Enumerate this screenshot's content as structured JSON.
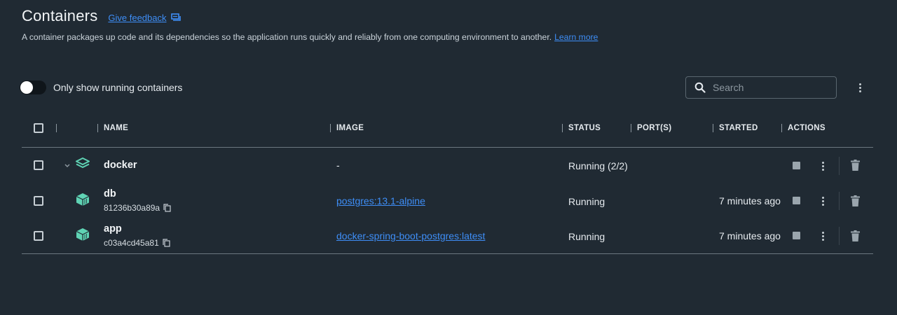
{
  "header": {
    "title": "Containers",
    "feedback_label": "Give feedback",
    "description": "A container packages up code and its dependencies so the application runs quickly and reliably from one computing environment to another.",
    "learn_more": "Learn more"
  },
  "filter": {
    "toggle_label": "Only show running containers",
    "toggle_on": false
  },
  "search": {
    "placeholder": "Search"
  },
  "table": {
    "columns": [
      "NAME",
      "IMAGE",
      "STATUS",
      "PORT(S)",
      "STARTED",
      "ACTIONS"
    ],
    "group": {
      "name": "docker",
      "image": "-",
      "status": "Running (2/2)",
      "expanded": true
    },
    "rows": [
      {
        "name": "db",
        "id": "81236b30a89a",
        "image": "postgres:13.1-alpine",
        "status": "Running",
        "started": "7 minutes ago"
      },
      {
        "name": "app",
        "id": "c03a4cd45a81",
        "image": "docker-spring-boot-postgres:latest",
        "status": "Running",
        "started": "7 minutes ago"
      }
    ]
  },
  "colors": {
    "background": "#202a33",
    "link": "#3e8ef7",
    "container_icon": "#5fd3b4"
  },
  "icons": [
    "feedback-icon",
    "search-icon",
    "kebab-icon",
    "chevron-down-icon",
    "stack-icon",
    "container-icon",
    "copy-icon",
    "stop-icon",
    "trash-icon"
  ]
}
